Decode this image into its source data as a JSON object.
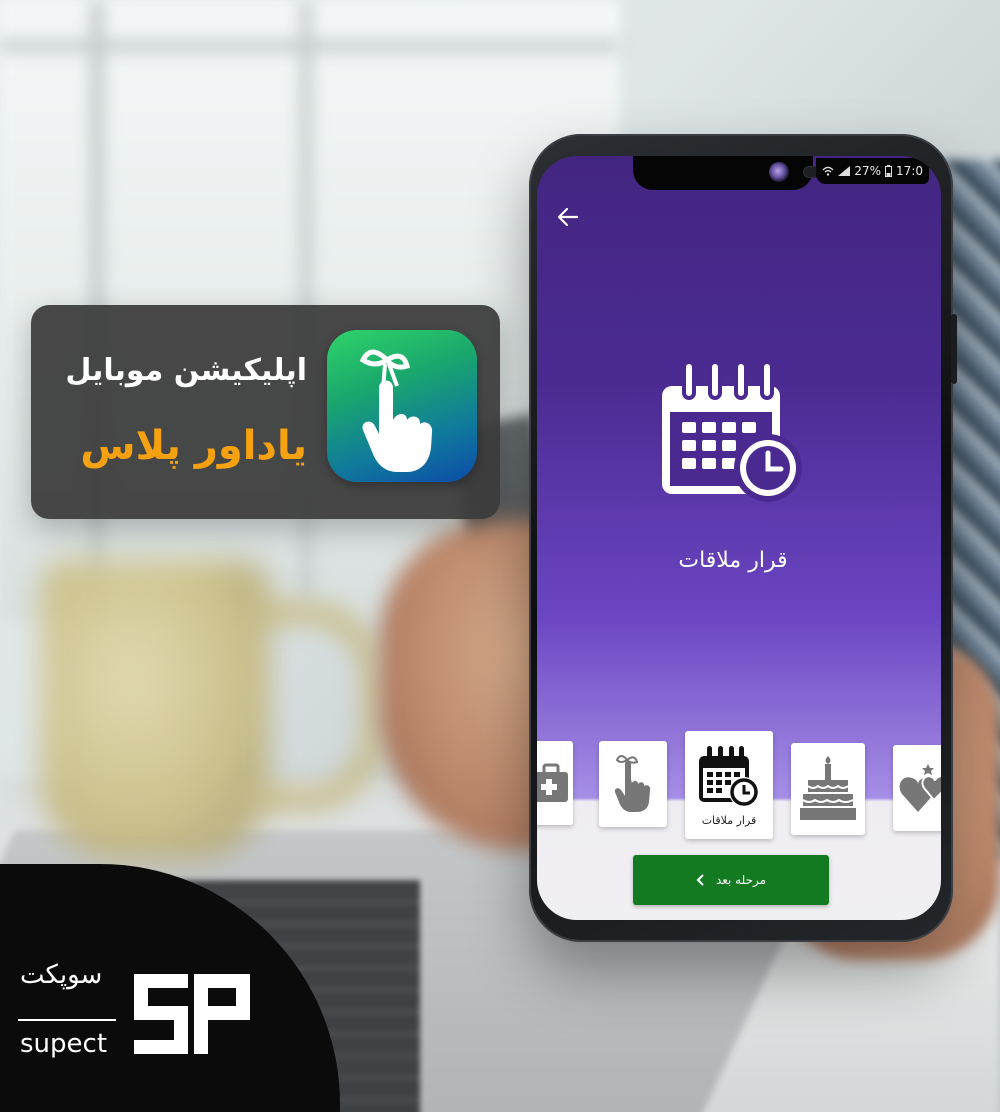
{
  "banner": {
    "subtitle": "اپلیکیشن موبایل",
    "title": "یاداور پلاس",
    "icon": "finger-ribbon-icon"
  },
  "status_bar": {
    "battery": "27%",
    "time": "17:0"
  },
  "screen": {
    "back_icon": "arrow-left-icon",
    "hero_icon": "calendar-clock-icon",
    "hero_label": "قرار ملاقات",
    "carousel": [
      {
        "icon": "first-aid-kit-icon",
        "label": ""
      },
      {
        "icon": "finger-ribbon-icon",
        "label": ""
      },
      {
        "icon": "calendar-clock-icon",
        "label": "قرار ملاقات",
        "selected": true
      },
      {
        "icon": "birthday-cake-icon",
        "label": ""
      },
      {
        "icon": "hearts-icon",
        "label": ""
      }
    ],
    "next_button": "مرحله بعد"
  },
  "brand": {
    "name_fa": "سوپکت",
    "name_en": "supect",
    "logo_text": "SP"
  },
  "colors": {
    "banner_accent": "#f6a10f",
    "screen_top": "#432581",
    "screen_mid": "#6b45c2",
    "next_button": "#137a22"
  }
}
